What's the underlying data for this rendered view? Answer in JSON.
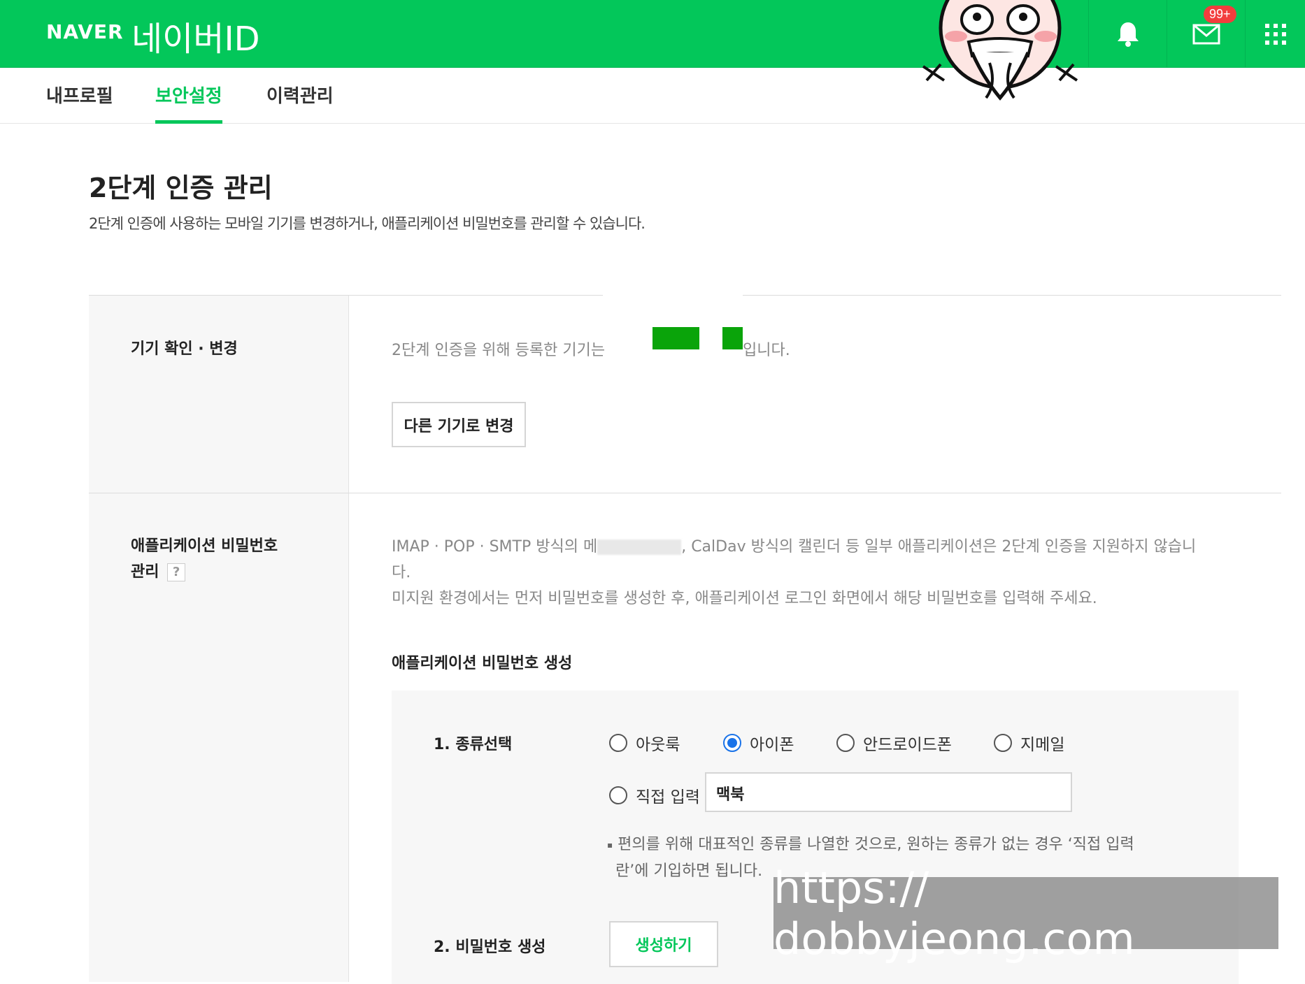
{
  "header": {
    "brand": "NAVER",
    "service": "네이버ID",
    "mail_badge": "99+"
  },
  "tabs": [
    {
      "label": "내프로필",
      "active": false
    },
    {
      "label": "보안설정",
      "active": true
    },
    {
      "label": "이력관리",
      "active": false
    }
  ],
  "page": {
    "title": "2단계 인증 관리",
    "description": "2단계 인증에 사용하는 모바일 기기를 변경하거나, 애플리케이션 비밀번호를 관리할 수 있습니다."
  },
  "device_section": {
    "label": "기기 확인 · 변경",
    "text_before": "2단계 인증을 위해 등록한 기기는",
    "text_after": "입니다.",
    "change_button": "다른 기기로 변경"
  },
  "app_password_section": {
    "label_line1": "애플리케이션 비밀번호",
    "label_line2": "관리",
    "help": "?",
    "desc_line1_a": "IMAP · POP · SMTP 방식의 메",
    "desc_line1_b": ", CalDav 방식의 캘린더 등 일부 애플리케이션은 2단계 인증을 지원하지 않습니",
    "desc_line2": "다.",
    "desc_line3": "미지원 환경에서는 먼저 비밀번호를 생성한 후, 애플리케이션 로그인 화면에서 해당 비밀번호를 입력해 주세요.",
    "subheading": "애플리케이션 비밀번호 생성",
    "step1_label": "1. 종류선택",
    "options": [
      {
        "label": "아웃룩",
        "selected": false
      },
      {
        "label": "아이폰",
        "selected": true
      },
      {
        "label": "안드로이드폰",
        "selected": false
      },
      {
        "label": "지메일",
        "selected": false
      }
    ],
    "direct_input_label": "직접 입력",
    "direct_input_value": "맥북",
    "note_line1": "편의를 위해 대표적인 종류를 나열한 것으로, 원하는 종류가 없는 경우 ‘직접 입력",
    "note_line2": "란’에 기입하면 됩니다.",
    "step2_label": "2. 비밀번호 생성",
    "generate_button": "생성하기"
  },
  "watermark": "https:// dobbyjeong.com",
  "colors": {
    "brand_green": "#03c75a",
    "radio_blue": "#1a73e8"
  }
}
